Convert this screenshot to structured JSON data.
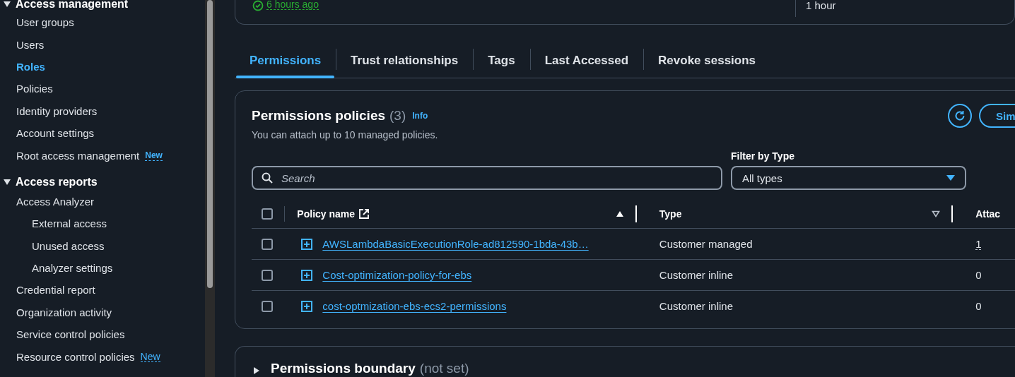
{
  "sidebar": {
    "sections": [
      {
        "title": "Access management",
        "expanded": true,
        "items": [
          {
            "label": "User groups",
            "selected": false
          },
          {
            "label": "Users",
            "selected": false
          },
          {
            "label": "Roles",
            "selected": true
          },
          {
            "label": "Policies",
            "selected": false
          },
          {
            "label": "Identity providers",
            "selected": false
          },
          {
            "label": "Account settings",
            "selected": false
          },
          {
            "label": "Root access management",
            "selected": false,
            "badge": "New"
          }
        ]
      },
      {
        "title": "Access reports",
        "expanded": true,
        "items": [
          {
            "label": "Access Analyzer",
            "selected": false,
            "children": [
              {
                "label": "External access",
                "selected": false
              },
              {
                "label": "Unused access",
                "selected": false
              },
              {
                "label": "Analyzer settings",
                "selected": false
              }
            ]
          },
          {
            "label": "Credential report",
            "selected": false
          },
          {
            "label": "Organization activity",
            "selected": false
          },
          {
            "label": "Service control policies",
            "selected": false
          },
          {
            "label": "Resource control policies",
            "selected": false,
            "badge": "New"
          }
        ]
      }
    ]
  },
  "summary": {
    "last_activity": "6 hours ago",
    "max_session": "1 hour"
  },
  "tabs": [
    {
      "label": "Permissions",
      "selected": true
    },
    {
      "label": "Trust relationships",
      "selected": false
    },
    {
      "label": "Tags",
      "selected": false
    },
    {
      "label": "Last Accessed",
      "selected": false
    },
    {
      "label": "Revoke sessions",
      "selected": false
    }
  ],
  "permissions_policies": {
    "title": "Permissions policies",
    "count": "(3)",
    "info": "Info",
    "description": "You can attach up to 10 managed policies.",
    "simulate_button": "Sim",
    "search": {
      "placeholder": "Search"
    },
    "filter": {
      "label": "Filter by Type",
      "value": "All types"
    },
    "table": {
      "all_checked": false,
      "columns": [
        {
          "label": "Policy name",
          "sortable": true,
          "sorted": true,
          "external": true
        },
        {
          "label": "Type",
          "sortable": true,
          "sorted": false,
          "external": false
        },
        {
          "label": "Attac",
          "sortable": false,
          "external": false
        }
      ],
      "rows": [
        {
          "checked": false,
          "name": "AWSLambdaBasicExecutionRole-ad812590-1bda-43b…",
          "type": "Customer managed",
          "attached": "1",
          "attached_link": true
        },
        {
          "checked": false,
          "name": "Cost-optimization-policy-for-ebs",
          "type": "Customer inline",
          "attached": "0",
          "attached_link": false
        },
        {
          "checked": false,
          "name": "cost-optmization-ebs-ecs2-permissions",
          "type": "Customer inline",
          "attached": "0",
          "attached_link": false
        }
      ]
    }
  },
  "permissions_boundary": {
    "title": "Permissions boundary",
    "status": "(not set)",
    "expanded": false
  }
}
